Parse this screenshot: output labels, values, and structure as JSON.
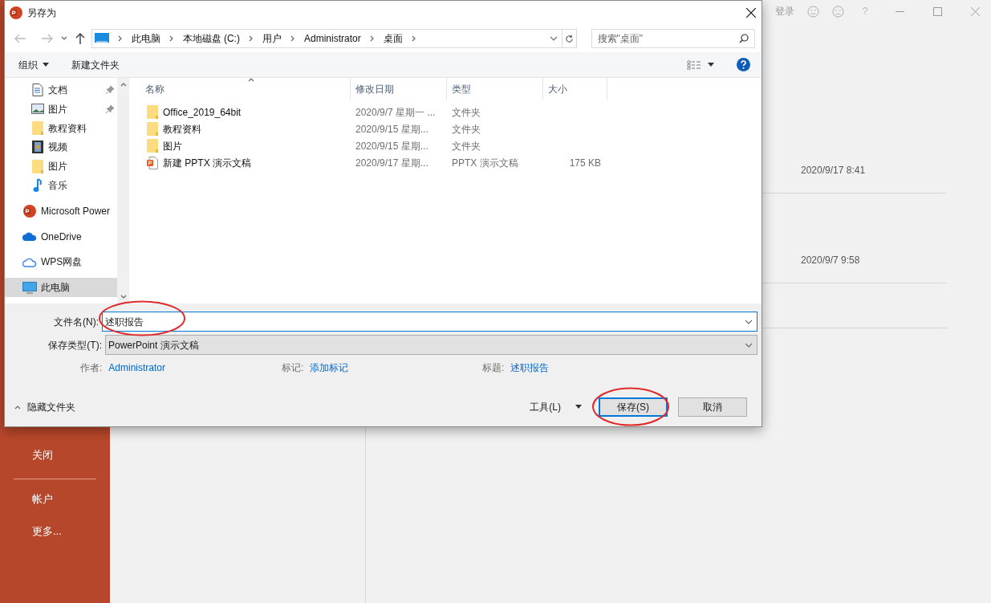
{
  "backstage": {
    "top_bar": {
      "sign_in": "登录",
      "help": "?"
    },
    "sidebar": {
      "items": [
        {
          "label": "关闭",
          "divider_after": true
        },
        {
          "label": "帐户",
          "divider_after": false
        },
        {
          "label": "更多...",
          "divider_after": false
        }
      ]
    },
    "recent": [
      {
        "time": "2020/9/17 8:41"
      },
      {
        "time": "2020/9/7 9:58"
      }
    ]
  },
  "dialog": {
    "title": "另存为",
    "address": {
      "segments": [
        "此电脑",
        "本地磁盘 (C:)",
        "用户",
        "Administrator",
        "桌面"
      ]
    },
    "search": {
      "placeholder": "搜索\"桌面\""
    },
    "toolbar": {
      "organize": "组织",
      "new_folder": "新建文件夹"
    },
    "quick_access": [
      {
        "label": "文档",
        "kind": "document",
        "pinned": true
      },
      {
        "label": "图片",
        "kind": "image",
        "pinned": true
      },
      {
        "label": "教程资料",
        "kind": "folder",
        "pinned": false
      },
      {
        "label": "视频",
        "kind": "video",
        "pinned": false
      },
      {
        "label": "图片",
        "kind": "folder",
        "pinned": false
      },
      {
        "label": "音乐",
        "kind": "music",
        "pinned": false
      }
    ],
    "locations": [
      {
        "label": "Microsoft Power",
        "kind": "ppt",
        "selected": false
      },
      {
        "label": "OneDrive",
        "kind": "onedrive",
        "selected": false
      },
      {
        "label": "WPS网盘",
        "kind": "cloud",
        "selected": false
      },
      {
        "label": "此电脑",
        "kind": "pc",
        "selected": true
      }
    ],
    "table": {
      "columns": [
        "名称",
        "修改日期",
        "类型",
        "大小"
      ],
      "rows": [
        {
          "name": "Office_2019_64bit",
          "modified": "2020/9/7 星期一 ...",
          "type": "文件夹",
          "size": "",
          "kind": "folder"
        },
        {
          "name": "教程资料",
          "modified": "2020/9/15 星期...",
          "type": "文件夹",
          "size": "",
          "kind": "folder"
        },
        {
          "name": "图片",
          "modified": "2020/9/15 星期...",
          "type": "文件夹",
          "size": "",
          "kind": "folder"
        },
        {
          "name": "新建 PPTX 演示文稿",
          "modified": "2020/9/17 星期...",
          "type": "PPTX 演示文稿",
          "size": "175 KB",
          "kind": "pptx"
        }
      ]
    },
    "file_name": {
      "label": "文件名(N):",
      "value": "述职报告"
    },
    "save_type": {
      "label": "保存类型(T):",
      "value": "PowerPoint 演示文稿"
    },
    "meta": [
      {
        "label": "作者:",
        "value": "Administrator"
      },
      {
        "label": "标记:",
        "value": "添加标记"
      },
      {
        "label": "标题:",
        "value": "述职报告"
      }
    ],
    "hide_folders": "隐藏文件夹",
    "tools": "工具(L)",
    "buttons": [
      "保存(S)",
      "取消"
    ]
  }
}
